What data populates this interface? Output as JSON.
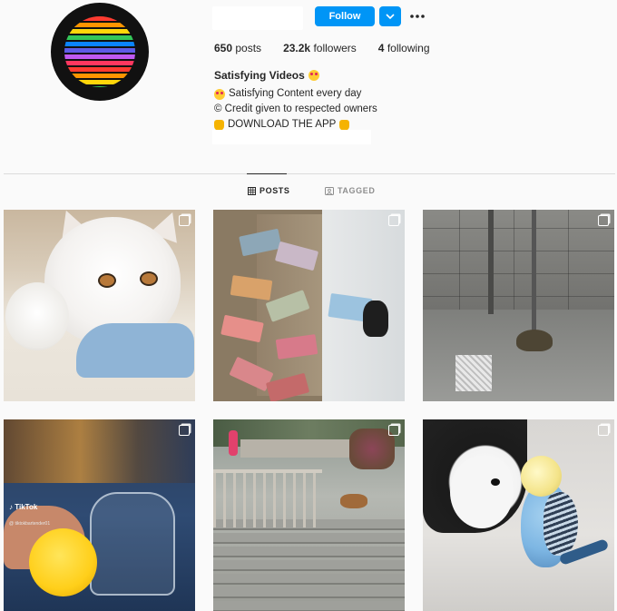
{
  "profile": {
    "avatar_icon": "rainbow-stripes-logo",
    "follow_label": "Follow",
    "dropdown_icon": "chevron-down-icon",
    "more_icon": "more-options-icon",
    "stats": {
      "posts_count": "650",
      "posts_label": "posts",
      "followers_count": "23.2k",
      "followers_label": "followers",
      "following_count": "4",
      "following_label": "following"
    },
    "full_name": "Satisfying Videos",
    "bio": [
      "Satisfying Content every day",
      "© Credit given to respected owners",
      "DOWNLOAD THE APP"
    ]
  },
  "tabs": {
    "posts_label": "POSTS",
    "tagged_label": "TAGGED"
  },
  "posts": [
    {
      "subject": "cats",
      "type_icon": "carousel-icon"
    },
    {
      "subject": "money",
      "type_icon": "carousel-icon"
    },
    {
      "subject": "shower",
      "type_icon": "carousel-icon"
    },
    {
      "subject": "lemon",
      "type_icon": "carousel-icon",
      "watermark_brand": "TikTok",
      "watermark_user": "@ tiktokbartender01"
    },
    {
      "subject": "stairs",
      "type_icon": "carousel-icon"
    },
    {
      "subject": "puppy-parrot",
      "type_icon": "carousel-icon"
    }
  ],
  "colors": {
    "accent": "#0095f6",
    "text": "#262626",
    "muted": "#8e8e8e",
    "background": "#fafafa",
    "divider": "#dbdbdb"
  }
}
